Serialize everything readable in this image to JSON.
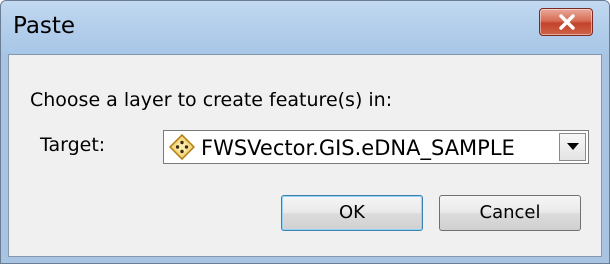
{
  "window": {
    "title": "Paste",
    "close_icon": "close-x-icon"
  },
  "dialog": {
    "prompt": "Choose a layer to create feature(s) in:",
    "target_label": "Target:",
    "target_value": "FWSVector.GIS.eDNA_SAMPLE",
    "target_icon": "point-feature-layer-icon",
    "dropdown_icon": "chevron-down-icon"
  },
  "buttons": {
    "ok_label": "OK",
    "cancel_label": "Cancel"
  },
  "colors": {
    "title_bar": "#b6d0ec",
    "close_button": "#c2432b",
    "dialog_background": "#f0f0f0",
    "default_button_border": "#3c7fb1"
  }
}
